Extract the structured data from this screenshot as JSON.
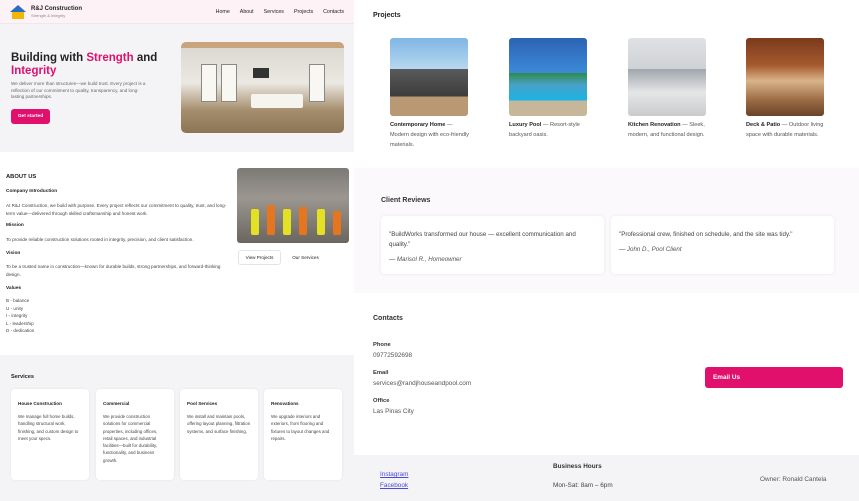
{
  "brand": {
    "name": "R&J Construction",
    "tagline": "Strength & Integrity"
  },
  "nav": [
    "Home",
    "About",
    "Services",
    "Projects",
    "Contacts"
  ],
  "hero": {
    "title_pre": "Building with ",
    "title_hl1": "Strength",
    "title_mid": " and ",
    "title_hl2": "Integrity",
    "text": "We deliver more than structures—we build trust. Every project is a reflection of our commitment to quality, transparency, and long-lasting partnerships.",
    "cta": "Get started"
  },
  "about": {
    "heading": "ABOUT US",
    "intro_label": "Company Introduction",
    "intro_text": "At R&J Construction, we build with purpose. Every project reflects our commitment to quality, trust, and long-term value—delivered through skilled craftsmanship and honest work.",
    "mission_label": "Mission",
    "mission_text": "To provide reliable construction solutions rooted in integrity, precision, and client satisfaction.",
    "vision_label": "Vision",
    "vision_text": "To be a trusted name in construction—known for durable builds, strong partnerships, and forward-thinking design.",
    "values_label": "Values",
    "values": [
      "B - balance",
      "U - unity",
      "I - integrity",
      "L - leadership",
      "D - dedication"
    ],
    "btn_projects": "View Projects",
    "btn_services": "Our Services"
  },
  "services": {
    "heading": "Services",
    "items": [
      {
        "title": "House Construction",
        "desc": "We manage full home builds, handling structural work, finishing, and custom design to meet your specs."
      },
      {
        "title": "Commercial",
        "desc": "We provide construction solutions for commercial properties, including offices, retail spaces, and industrial facilities—built for durability, functionality, and business growth."
      },
      {
        "title": "Pool Services",
        "desc": "We install and maintain pools, offering layout planning, filtration systems, and surface finishing."
      },
      {
        "title": "Renovations",
        "desc": "We upgrade interiors and exteriors, from flooring and fixtures to layout changes and repairs."
      }
    ]
  },
  "projects": {
    "heading": "Projects",
    "items": [
      {
        "title": "Contemporary Home",
        "desc": " — Modern design with eco-friendly materials.",
        "image": "modern-house-photo"
      },
      {
        "title": "Luxury Pool",
        "desc": " — Resort-style backyard oasis.",
        "image": "pool-photo"
      },
      {
        "title": "Kitchen Renovation",
        "desc": " — Sleek, modern, and functional design.",
        "image": "kitchen-photo"
      },
      {
        "title": "Deck & Patio",
        "desc": " — Outdoor living space with durable materials.",
        "image": "deck-photo"
      }
    ]
  },
  "reviews": {
    "heading": "Client Reviews",
    "items": [
      {
        "quote": "\"BuildWorks transformed our house — excellent communication and quality.\"",
        "author": "— Marisol R., Homeowner"
      },
      {
        "quote": "\"Professional crew, finished on schedule, and the site was tidy.\"",
        "author": "— John D., Pool Client"
      }
    ]
  },
  "contacts": {
    "heading": "Contacts",
    "phone_label": "Phone",
    "phone": "09772592698",
    "email_label": "Email",
    "email": "services@randjhouseandpool.com",
    "office_label": "Office",
    "office": "Las Pinas City",
    "email_btn": "Email Us"
  },
  "footer": {
    "instagram": "Instagram",
    "facebook": "Facebook",
    "hours_title": "Business Hours",
    "hours": "Mon-Sat: 8am – 6pm",
    "owner": "Owner: Ronald Cantela"
  },
  "colors": {
    "accent": "#e0106c",
    "link": "#4a4ad8"
  }
}
